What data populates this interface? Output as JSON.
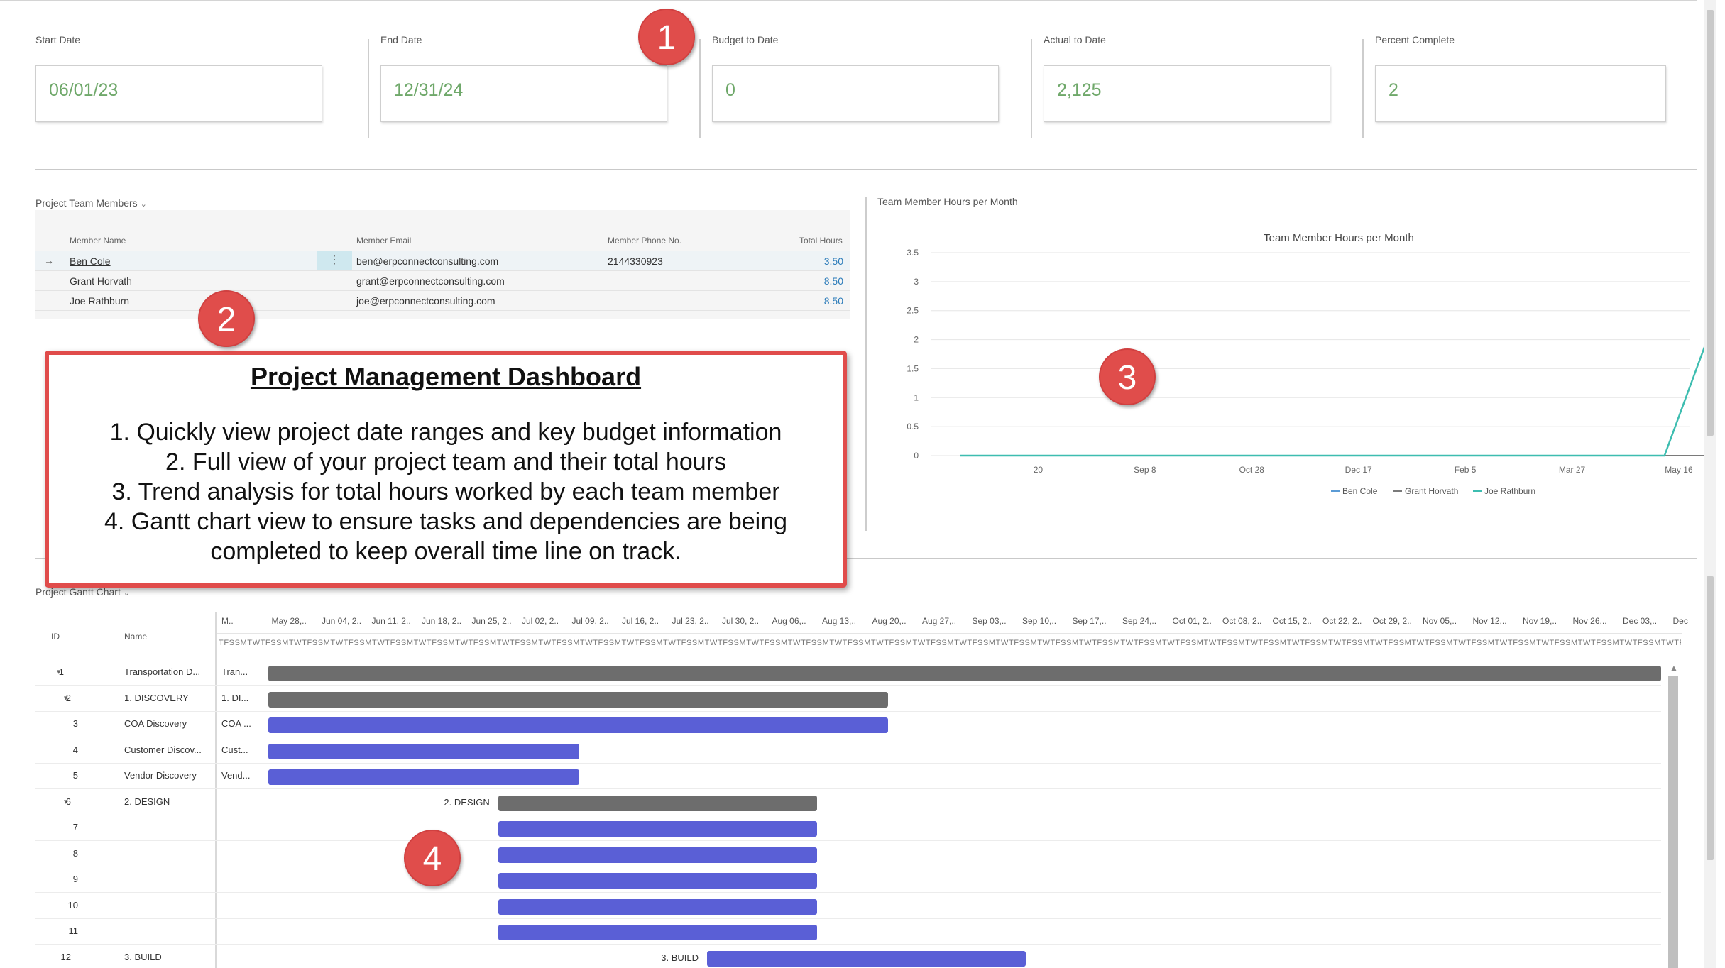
{
  "kpis": [
    {
      "label": "Start Date",
      "value": "06/01/23"
    },
    {
      "label": "End Date",
      "value": "12/31/24"
    },
    {
      "label": "Budget to Date",
      "value": "0"
    },
    {
      "label": "Actual to Date",
      "value": "2,125"
    },
    {
      "label": "Percent Complete",
      "value": "2"
    }
  ],
  "team": {
    "title": "Project Team Members",
    "columns": [
      "Member Name",
      "Member Email",
      "Member Phone No.",
      "Total Hours"
    ],
    "rows": [
      {
        "name": "Ben Cole",
        "email": "ben@erpconnectconsulting.com",
        "phone": "2144330923",
        "hours": "3.50"
      },
      {
        "name": "Grant Horvath",
        "email": "grant@erpconnectconsulting.com",
        "phone": "",
        "hours": "8.50"
      },
      {
        "name": "Joe Rathburn",
        "email": "joe@erpconnectconsulting.com",
        "phone": "",
        "hours": "8.50"
      }
    ]
  },
  "callout": {
    "title": "Project Management Dashboard",
    "lines": [
      "1. Quickly view project date ranges and key budget information",
      "2. Full view of your project team and their total hours",
      "3. Trend analysis for total hours worked by each team member",
      "4. Gantt chart view to ensure tasks and dependencies are being",
      "completed to keep overall time line on track."
    ]
  },
  "badges": [
    "1",
    "2",
    "3",
    "4"
  ],
  "chart_section_title": "Team Member Hours per Month",
  "chart_data": {
    "type": "line",
    "title": "Team Member Hours per Month",
    "x": [
      "20",
      "Sep 8",
      "Oct 28",
      "Dec 17",
      "Feb 5",
      "Mar 27",
      "May 16"
    ],
    "yticks": [
      "0",
      "0.5",
      "1",
      "1.5",
      "2",
      "2.5",
      "3",
      "3.5"
    ],
    "ylim": [
      0,
      3.5
    ],
    "series": [
      {
        "name": "Ben Cole",
        "color": "#5b9bd5",
        "points": [
          [
            0,
            0
          ],
          [
            7.0,
            0
          ]
        ]
      },
      {
        "name": "Grant Horvath",
        "color": "#7a7a7a",
        "points": [
          [
            0,
            0
          ],
          [
            7.0,
            0
          ]
        ]
      },
      {
        "name": "Joe Rathburn",
        "color": "#3dbdb0",
        "points": [
          [
            0,
            0
          ],
          [
            6.6,
            0
          ],
          [
            7.3,
            3.5
          ]
        ]
      }
    ],
    "legend": "bottom"
  },
  "gantt": {
    "title": "Project Gantt Chart",
    "id_header": "ID",
    "name_header": "Name",
    "months": [
      "M..",
      "May 28,..",
      "Jun 04, 2..",
      "Jun 11, 2..",
      "Jun 18, 2..",
      "Jun 25, 2..",
      "Jul 02, 2..",
      "Jul 09, 2..",
      "Jul 16, 2..",
      "Jul 23, 2..",
      "Jul 30, 2..",
      "Aug 06,..",
      "Aug 13,..",
      "Aug 20,..",
      "Aug 27,..",
      "Sep 03,..",
      "Sep 10,..",
      "Sep 17,..",
      "Sep 24,..",
      "Oct 01, 2..",
      "Oct 08, 2..",
      "Oct 15, 2..",
      "Oct 22, 2..",
      "Oct 29, 2..",
      "Nov 05,..",
      "Nov 12,..",
      "Nov 19,..",
      "Nov 26,..",
      "Dec 03,..",
      "Dec"
    ],
    "days": "TFSSMTWTFSSMTWTFSSMTWTFSSMTWTFSSMTWTFSSMTWTFSSMTWTFSSMTWTFSSMTWTFSSMTWTFSSMTWTFSSMTWTFSSMTWTFSSMTWTFSSMTWTFSSMTWTFSSMTWTFSSMTWTFSSMTWTFSSMTWTFSSMTWTFSSMTWTFSSMTWTFSSMTWTFSSMTWTFSSMTWTFSSMTWTFSSMTWTFSSMTWTFSSMTWTFSSMTWTFSSMTWTFSSMTWTFSSMTWTFSSMTWTFSSMTWTFSSMTWTFSSMTWTFSSMTWTFSSMTWTFSSMTWTFSSMTWTFSSMTWTFSSMTW",
    "rows": [
      {
        "id": "1",
        "name": "Transportation D...",
        "short": "Tran...",
        "type": "sum",
        "tri": true,
        "indent": 0,
        "bar_label": "",
        "start": 0.0,
        "end": 1.0
      },
      {
        "id": "2",
        "name": "1. DISCOVERY",
        "short": "1. DI...",
        "type": "sum",
        "tri": true,
        "indent": 1,
        "bar_label": "",
        "start": 0.0,
        "end": 0.445
      },
      {
        "id": "3",
        "name": "COA Discovery",
        "short": "COA ...",
        "type": "task",
        "tri": false,
        "indent": 2,
        "bar_label": "",
        "start": 0.0,
        "end": 0.445
      },
      {
        "id": "4",
        "name": "Customer Discov...",
        "short": "Cust...",
        "type": "task",
        "tri": false,
        "indent": 2,
        "bar_label": "",
        "start": 0.0,
        "end": 0.223
      },
      {
        "id": "5",
        "name": "Vendor Discovery",
        "short": "Vend...",
        "type": "task",
        "tri": false,
        "indent": 2,
        "bar_label": "",
        "start": 0.0,
        "end": 0.223
      },
      {
        "id": "6",
        "name": "2. DESIGN",
        "short": "",
        "type": "sum",
        "tri": true,
        "indent": 1,
        "bar_label": "2. DESIGN",
        "start": 0.165,
        "end": 0.394
      },
      {
        "id": "7",
        "name": "",
        "short": "",
        "type": "task",
        "tri": false,
        "indent": 2,
        "bar_label": "",
        "start": 0.165,
        "end": 0.394
      },
      {
        "id": "8",
        "name": "",
        "short": "",
        "type": "task",
        "tri": false,
        "indent": 2,
        "bar_label": "",
        "start": 0.165,
        "end": 0.394
      },
      {
        "id": "9",
        "name": "",
        "short": "",
        "type": "task",
        "tri": false,
        "indent": 2,
        "bar_label": "",
        "start": 0.165,
        "end": 0.394
      },
      {
        "id": "10",
        "name": "",
        "short": "",
        "type": "task",
        "tri": false,
        "indent": 2,
        "bar_label": "",
        "start": 0.165,
        "end": 0.394
      },
      {
        "id": "11",
        "name": "",
        "short": "",
        "type": "task",
        "tri": false,
        "indent": 2,
        "bar_label": "",
        "start": 0.165,
        "end": 0.394
      },
      {
        "id": "12",
        "name": "3. BUILD",
        "short": "",
        "type": "task",
        "tri": false,
        "indent": 1,
        "bar_label": "3. BUILD",
        "start": 0.315,
        "end": 0.544
      }
    ]
  }
}
